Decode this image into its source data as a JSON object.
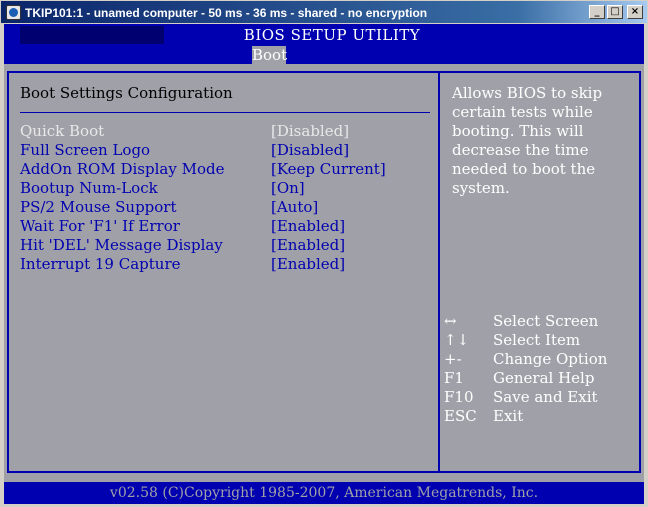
{
  "window": {
    "title": "TKIP101:1 - unamed computer - 50 ms - 36 ms - shared - no encryption",
    "minimize_glyph": "_",
    "maximize_glyph": "□",
    "close_glyph": "×"
  },
  "bios": {
    "title": "BIOS SETUP UTILITY",
    "active_tab": "Boot",
    "section_title": "Boot Settings Configuration",
    "settings": [
      {
        "label": "Quick Boot",
        "value": "[Disabled]",
        "selected": true
      },
      {
        "label": "Full Screen Logo",
        "value": "[Disabled]",
        "selected": false
      },
      {
        "label": "AddOn ROM Display Mode",
        "value": "[Keep Current]",
        "selected": false
      },
      {
        "label": "Bootup Num-Lock",
        "value": "[On]",
        "selected": false
      },
      {
        "label": "PS/2 Mouse Support",
        "value": "[Auto]",
        "selected": false
      },
      {
        "label": "Wait For 'F1' If Error",
        "value": "[Enabled]",
        "selected": false
      },
      {
        "label": "Hit 'DEL' Message Display",
        "value": "[Enabled]",
        "selected": false
      },
      {
        "label": "Interrupt 19 Capture",
        "value": "[Enabled]",
        "selected": false
      }
    ],
    "help_lines": [
      "Allows BIOS to skip",
      "certain tests while",
      "booting. This will",
      "decrease the time",
      "needed to boot the",
      "system."
    ],
    "keys": [
      {
        "key": "↔",
        "desc": "Select Screen"
      },
      {
        "key": "↑↓",
        "desc": "Select Item"
      },
      {
        "key": "+-",
        "desc": "Change Option"
      },
      {
        "key": "F1",
        "desc": "General Help"
      },
      {
        "key": "F10",
        "desc": "Save and Exit"
      },
      {
        "key": "ESC",
        "desc": "Exit"
      }
    ],
    "footer": "v02.58 (C)Copyright 1985-2007, American Megatrends, Inc."
  },
  "colors": {
    "bios_blue": "#0000b0",
    "bios_gray": "#a0a0a8",
    "titlebar": "#0a246a"
  }
}
